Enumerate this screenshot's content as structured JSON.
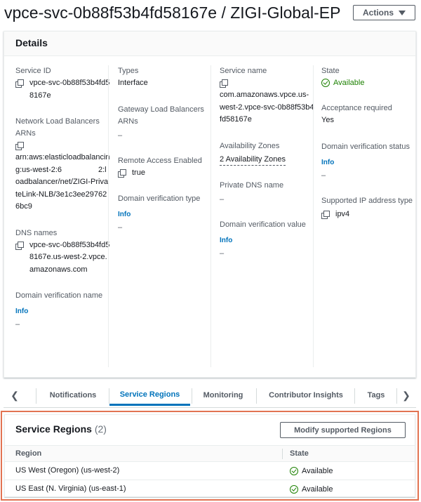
{
  "header": {
    "title": "vpce-svc-0b88f53b4fd58167e / ZIGI-Global-EP",
    "actions_label": "Actions"
  },
  "details": {
    "title": "Details",
    "service_id": {
      "label": "Service ID",
      "value": "vpce-svc-0b88f53b4fd58167e"
    },
    "nlb_arns": {
      "label": "Network Load Balancers ARNs",
      "value": "arn:aws:elasticloadbalancing:us-west-2:6                 2:loadbalancer/net/ZIGI-PrivateLink-NLB/3e1c3ee297626bc9"
    },
    "dns_names": {
      "label": "DNS names",
      "value": "vpce-svc-0b88f53b4fd58167e.us-west-2.vpce.amazonaws.com"
    },
    "domain_verification_name": {
      "label": "Domain verification name",
      "info": "Info",
      "value": "–"
    },
    "types": {
      "label": "Types",
      "value": "Interface"
    },
    "gwlb_arns": {
      "label": "Gateway Load Balancers ARNs",
      "value": "–"
    },
    "remote_access": {
      "label": "Remote Access Enabled",
      "value": "true"
    },
    "domain_verification_type": {
      "label": "Domain verification type",
      "info": "Info",
      "value": "–"
    },
    "service_name": {
      "label": "Service name",
      "value": "com.amazonaws.vpce.us-west-2.vpce-svc-0b88f53b4fd58167e"
    },
    "availability_zones": {
      "label": "Availability Zones",
      "value": "2 Availability Zones"
    },
    "private_dns": {
      "label": "Private DNS name",
      "value": "–"
    },
    "domain_verification_value": {
      "label": "Domain verification value",
      "info": "Info",
      "value": "–"
    },
    "state": {
      "label": "State",
      "value": "Available"
    },
    "acceptance": {
      "label": "Acceptance required",
      "value": "Yes"
    },
    "domain_verification_status": {
      "label": "Domain verification status",
      "info": "Info",
      "value": "–"
    },
    "ip_type": {
      "label": "Supported IP address type",
      "value": "ipv4"
    }
  },
  "tabs": {
    "items": [
      "Notifications",
      "Service Regions",
      "Monitoring",
      "Contributor Insights",
      "Tags"
    ],
    "active": "Service Regions"
  },
  "service_regions": {
    "title": "Service Regions",
    "count": "(2)",
    "modify_label": "Modify supported Regions",
    "columns": [
      "Region",
      "State"
    ],
    "rows": [
      {
        "region": "US West (Oregon) (us-west-2)",
        "state": "Available"
      },
      {
        "region": "US East (N. Virginia) (us-east-1)",
        "state": "Available"
      }
    ]
  },
  "colors": {
    "link": "#0073bb",
    "success": "#1d8102",
    "highlight_border": "#e27352"
  }
}
